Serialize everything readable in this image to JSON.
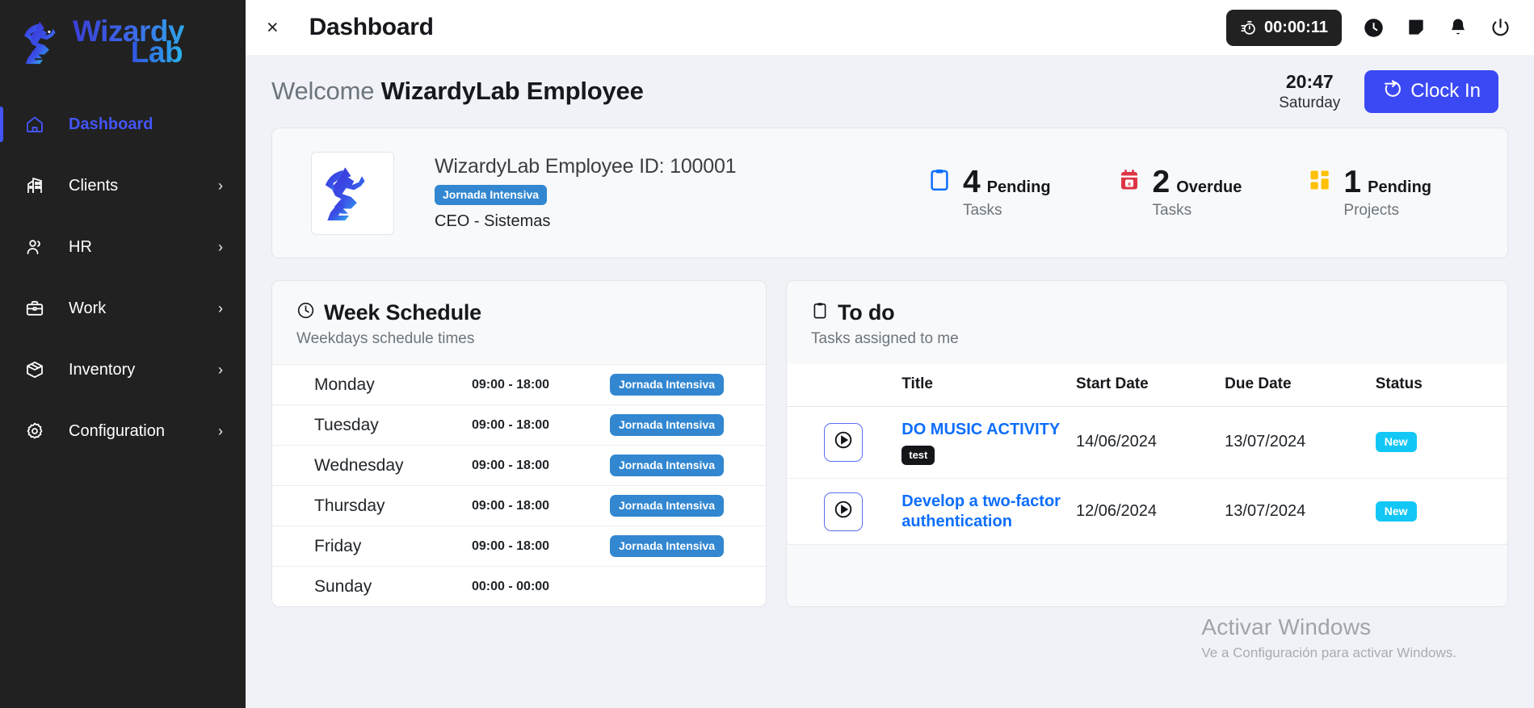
{
  "brand": {
    "name_part1": "Wizardy",
    "name_part2": "Lab",
    "logo_icon": "dragon-logo-icon"
  },
  "sidebar": {
    "items": [
      {
        "label": "Dashboard",
        "icon": "home-icon",
        "active": true,
        "has_chevron": false
      },
      {
        "label": "Clients",
        "icon": "building-icon",
        "active": false,
        "has_chevron": true
      },
      {
        "label": "HR",
        "icon": "users-icon",
        "active": false,
        "has_chevron": true
      },
      {
        "label": "Work",
        "icon": "briefcase-icon",
        "active": false,
        "has_chevron": true
      },
      {
        "label": "Inventory",
        "icon": "box-icon",
        "active": false,
        "has_chevron": true
      },
      {
        "label": "Configuration",
        "icon": "gear-icon",
        "active": false,
        "has_chevron": true
      }
    ]
  },
  "topbar": {
    "close_label": "×",
    "title": "Dashboard",
    "timer": "00:00:11",
    "timer_icon": "stopwatch-icon",
    "icons": [
      "clock-icon",
      "note-icon",
      "bell-icon",
      "power-icon"
    ]
  },
  "welcome": {
    "greeting": "Welcome",
    "user": "WizardyLab Employee",
    "time": "20:47",
    "day": "Saturday",
    "clock_in_label": "Clock In",
    "clock_in_icon": "login-arrow-icon",
    "clock_in_color": "#3B49F5"
  },
  "profile": {
    "name": "WizardyLab Employee",
    "id_label": "ID: 100001",
    "shift_badge": "Jornada Intensiva",
    "shift_badge_color": "#3287D0",
    "role": "CEO - Sistemas",
    "avatar_icon": "dragon-logo-icon",
    "stats": [
      {
        "icon": "clipboard-icon",
        "icon_color": "#0d6efd",
        "value": "4",
        "label_top": "Pending",
        "label_bottom": "Tasks"
      },
      {
        "icon": "calendar-x-icon",
        "icon_color": "#dc3545",
        "value": "2",
        "label_top": "Overdue",
        "label_bottom": "Tasks"
      },
      {
        "icon": "grid-icon",
        "icon_color": "#ffc107",
        "value": "1",
        "label_top": "Pending",
        "label_bottom": "Projects"
      }
    ]
  },
  "week_schedule": {
    "title": "Week Schedule",
    "title_icon": "clock-icon",
    "subtitle": "Weekdays schedule times",
    "rows": [
      {
        "day": "Monday",
        "time": "09:00 - 18:00",
        "badge": "Jornada Intensiva"
      },
      {
        "day": "Tuesday",
        "time": "09:00 - 18:00",
        "badge": "Jornada Intensiva"
      },
      {
        "day": "Wednesday",
        "time": "09:00 - 18:00",
        "badge": "Jornada Intensiva"
      },
      {
        "day": "Thursday",
        "time": "09:00 - 18:00",
        "badge": "Jornada Intensiva"
      },
      {
        "day": "Friday",
        "time": "09:00 - 18:00",
        "badge": "Jornada Intensiva"
      },
      {
        "day": "Sunday",
        "time": "00:00 - 00:00",
        "badge": ""
      }
    ]
  },
  "todo": {
    "title": "To do",
    "title_icon": "clipboard-icon",
    "subtitle": "Tasks assigned to me",
    "columns": [
      "",
      "Title",
      "Start Date",
      "Due Date",
      "Status"
    ],
    "rows": [
      {
        "play_icon": "play-circle-icon",
        "title": "DO MUSIC ACTIVITY",
        "tag": "test",
        "start_date": "14/06/2024",
        "due_date": "13/07/2024",
        "status": "New",
        "status_color": "#12C7F5"
      },
      {
        "play_icon": "play-circle-icon",
        "title": "Develop a two-factor authentication",
        "tag": "",
        "start_date": "12/06/2024",
        "due_date": "13/07/2024",
        "status": "New",
        "status_color": "#12C7F5"
      }
    ]
  },
  "watermark": {
    "line1": "Activar Windows",
    "line2": "Ve a Configuración para activar Windows."
  }
}
